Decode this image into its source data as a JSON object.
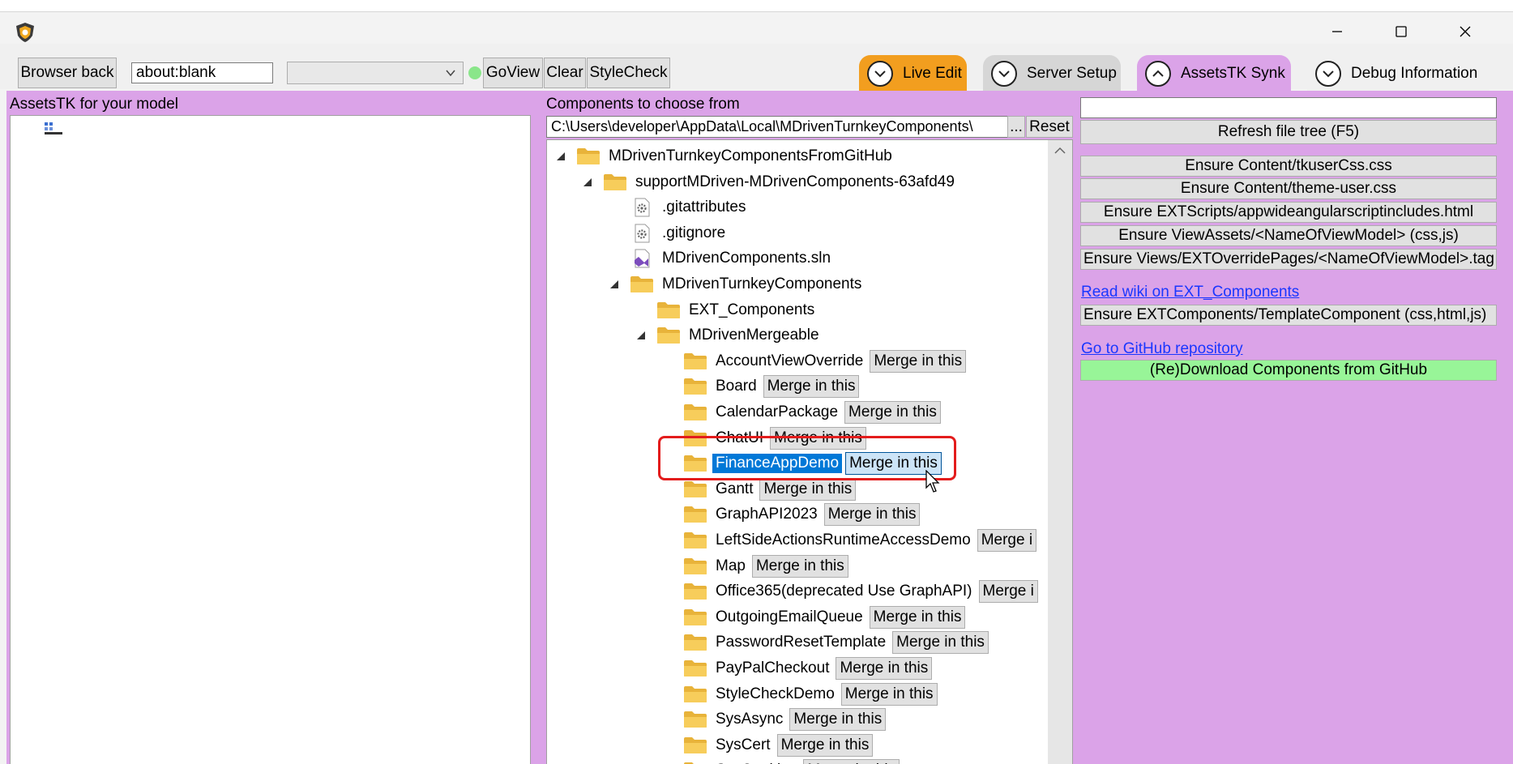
{
  "window": {
    "controls": {
      "minimize": "minimize",
      "maximize": "maximize",
      "close": "close"
    }
  },
  "toolbar": {
    "browser_back": "Browser back",
    "url_value": "about:blank",
    "combo_value": "",
    "goview": "GoView",
    "clear": "Clear",
    "stylecheck": "StyleCheck",
    "status_color": "#8ae68a"
  },
  "tabs": [
    {
      "label": "Live Edit",
      "color": "#f29e1f"
    },
    {
      "label": "Server Setup",
      "color": "#d6d6d6"
    },
    {
      "label": "AssetsTK Synk",
      "color": "#dba3e8"
    },
    {
      "label": "Debug Information",
      "color": "#f0f0f0"
    }
  ],
  "left_panel": {
    "label": "AssetsTK for your model"
  },
  "mid_panel": {
    "label": "Components to choose from",
    "path_value": "C:\\Users\\developer\\AppData\\Local\\MDrivenTurnkeyComponents\\",
    "browse": "...",
    "reset": "Reset",
    "tree": {
      "root": "MDrivenTurnkeyComponentsFromGitHub",
      "repo": "supportMDriven-MDrivenComponents-63afd49",
      "gitattributes": ".gitattributes",
      "gitignore": ".gitignore",
      "sln": "MDrivenComponents.sln",
      "turnkey": "MDrivenTurnkeyComponents",
      "ext": "EXT_Components",
      "mergeable": "MDrivenMergeable",
      "merge_label": "Merge in this",
      "merge_label_cut": "Merge i",
      "items": [
        "AccountViewOverride",
        "Board",
        "CalendarPackage",
        "ChatUI",
        "FinanceAppDemo",
        "Gantt",
        "GraphAPI2023",
        "LeftSideActionsRuntimeAccessDemo",
        "Map",
        "Office365(deprecated Use GraphAPI)",
        "OutgoingEmailQueue",
        "PasswordResetTemplate",
        "PayPalCheckout",
        "StyleCheckDemo",
        "SysAsync",
        "SysCert",
        "SysCookies"
      ]
    }
  },
  "right_panel": {
    "search_value": "",
    "refresh": "Refresh file tree (F5)",
    "ensure": [
      "Ensure Content/tkuserCss.css",
      "Ensure Content/theme-user.css",
      "Ensure EXTScripts/appwideangularscriptincludes.html",
      "Ensure ViewAssets/<NameOfViewModel> (css,js)",
      "Ensure Views/EXTOverridePages/<NameOfViewModel>.tag"
    ],
    "wiki_link": "Read wiki on EXT_Components",
    "template_btn": "Ensure EXTComponents/TemplateComponent (css,html,js)",
    "github_link": "Go to GitHub repository",
    "download_btn": "(Re)Download Components from GitHub",
    "download_color": "#98f598"
  }
}
